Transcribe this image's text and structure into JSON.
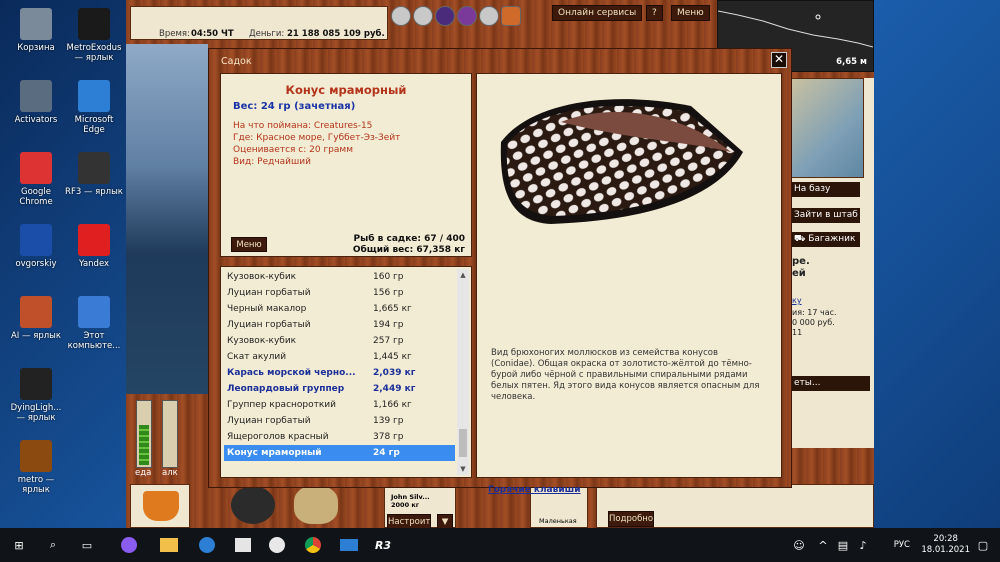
{
  "desktop": {
    "icons": [
      {
        "label": "Корзина"
      },
      {
        "label": "MetroExodus — ярлык"
      },
      {
        "label": "Activators"
      },
      {
        "label": "Microsoft Edge"
      },
      {
        "label": "Google Chrome"
      },
      {
        "label": "RF3 — ярлык"
      },
      {
        "label": "ovgorskiy"
      },
      {
        "label": "Yandex"
      },
      {
        "label": "AI — ярлык"
      },
      {
        "label": "Этот компьюте..."
      },
      {
        "label": "DyingLigh... — ярлык"
      },
      {
        "label": "metro — ярлык"
      }
    ]
  },
  "game": {
    "time_label": "Время:",
    "time_value": "04:50 ЧТ",
    "money_label": "Деньги:",
    "money_value": "21 188 085 109 руб.",
    "online_services": "Онлайн сервисы",
    "help": "?",
    "menu": "Меню",
    "depth": "6,65 м",
    "to_base": "На базу",
    "to_hq": "Зайти в штаб",
    "trunk": "Багажник",
    "side_texts": [
      "ре.",
      "ей",
      "ку",
      "ия: 17 час.",
      "0 000 руб.",
      "11",
      "еты..."
    ],
    "gauge_food": "еда",
    "gauge_alc": "алк",
    "bottom_note_name": "John Silv...",
    "bottom_note_weight": "2000 кг",
    "configure": "Настроить",
    "details": "Подробно",
    "small_label": "Маленькая"
  },
  "dialog": {
    "title": "Садок",
    "close": "✕",
    "fish": {
      "name": "Конус мраморный",
      "weight": "Вес: 24 гр (зачетная)",
      "bait": "На что поймана: Creatures-15",
      "place": "Где: Красное море, Губбет-Эз-Зейт",
      "valued_from": "Оценивается с: 20 грамм",
      "kind": "Вид: Редчайший"
    },
    "menu_button": "Меню",
    "fish_count": "Рыб в садке: 67 / 400",
    "total_weight": "Общий вес: 67,358 кг",
    "catch_list": [
      {
        "name": "Кузовок-кубик",
        "weight": "160 гр",
        "style": "normal"
      },
      {
        "name": "Луциан горбатый",
        "weight": "156 гр",
        "style": "normal"
      },
      {
        "name": "Черный макалор",
        "weight": "1,665 кг",
        "style": "normal"
      },
      {
        "name": "Луциан горбатый",
        "weight": "194 гр",
        "style": "normal"
      },
      {
        "name": "Кузовок-кубик",
        "weight": "257 гр",
        "style": "normal"
      },
      {
        "name": "Скат акулий",
        "weight": "1,445 кг",
        "style": "normal"
      },
      {
        "name": "Карась морской черно...",
        "weight": "2,039 кг",
        "style": "bold"
      },
      {
        "name": "Леопардовый группер",
        "weight": "2,449 кг",
        "style": "bold"
      },
      {
        "name": "Группер краснороткий",
        "weight": "1,166 кг",
        "style": "normal"
      },
      {
        "name": "Луциан горбатый",
        "weight": "139 гр",
        "style": "normal"
      },
      {
        "name": "Ящероголов красный",
        "weight": "378 гр",
        "style": "normal"
      },
      {
        "name": "Конус мраморный",
        "weight": "24 гр",
        "style": "selected"
      }
    ],
    "description": "Вид брюхоногих моллюсков из семейства конусов (Conidae). Общая окраска от золотисто-жёлтой до тёмно-бурой либо чёрной с правильными спиральными рядами белых пятен. Яд этого вида конусов является опасным для человека.",
    "hotkeys": "Горячие клавиши"
  },
  "taskbar": {
    "language": "РУС",
    "time": "20:28",
    "date": "18.01.2021"
  }
}
